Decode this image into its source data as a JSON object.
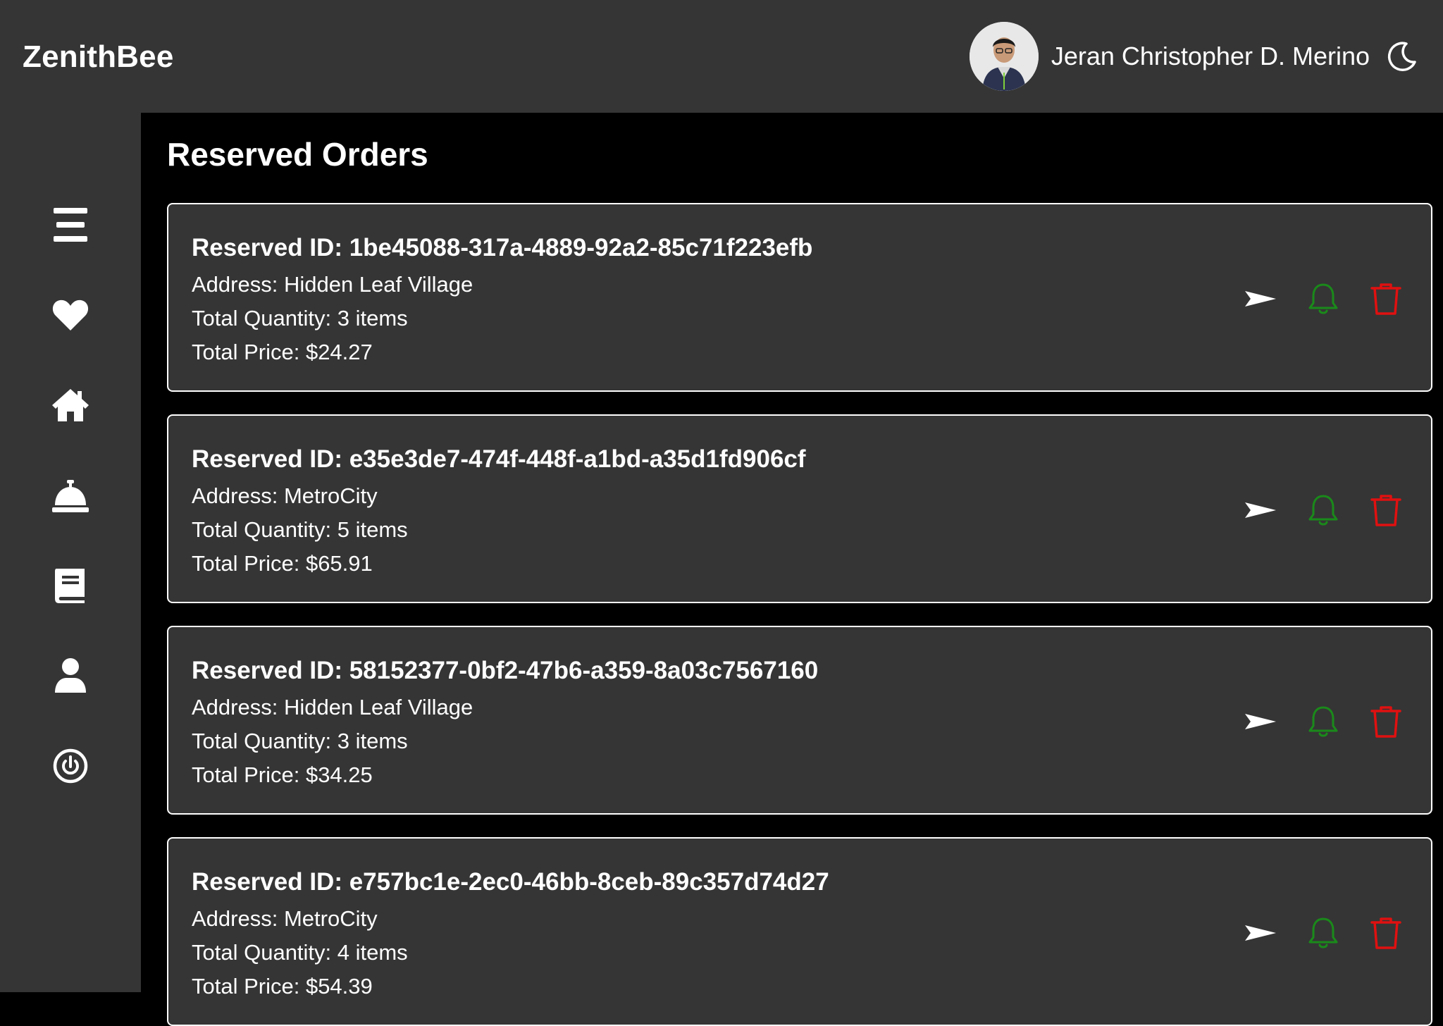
{
  "app": {
    "brand": "ZenithBee",
    "user_name": "Jeran Christopher D. Merino"
  },
  "icons": {
    "theme_toggle": "moon-icon",
    "sidebar": [
      "menu-icon",
      "heart-icon",
      "home-icon",
      "bell-concierge-icon",
      "book-icon",
      "user-icon",
      "power-icon"
    ],
    "actions": [
      "send-icon",
      "bell-icon",
      "trash-icon"
    ]
  },
  "colors": {
    "topbar": "#353535",
    "content_bg": "#000000",
    "card_bg": "#353535",
    "notify": "#1a8a1a",
    "delete": "#e01010"
  },
  "page": {
    "title": "Reserved Orders"
  },
  "orders": [
    {
      "id_line": "Reserved ID: 1be45088-317a-4889-92a2-85c71f223efb",
      "address_line": "Address: Hidden Leaf Village",
      "quantity_line": "Total Quantity: 3 items",
      "price_line": "Total Price: $24.27"
    },
    {
      "id_line": "Reserved ID: e35e3de7-474f-448f-a1bd-a35d1fd906cf",
      "address_line": "Address: MetroCity",
      "quantity_line": "Total Quantity: 5 items",
      "price_line": "Total Price: $65.91"
    },
    {
      "id_line": "Reserved ID: 58152377-0bf2-47b6-a359-8a03c7567160",
      "address_line": "Address: Hidden Leaf Village",
      "quantity_line": "Total Quantity: 3 items",
      "price_line": "Total Price: $34.25"
    },
    {
      "id_line": "Reserved ID: e757bc1e-2ec0-46bb-8ceb-89c357d74d27",
      "address_line": "Address: MetroCity",
      "quantity_line": "Total Quantity: 4 items",
      "price_line": "Total Price: $54.39"
    }
  ]
}
